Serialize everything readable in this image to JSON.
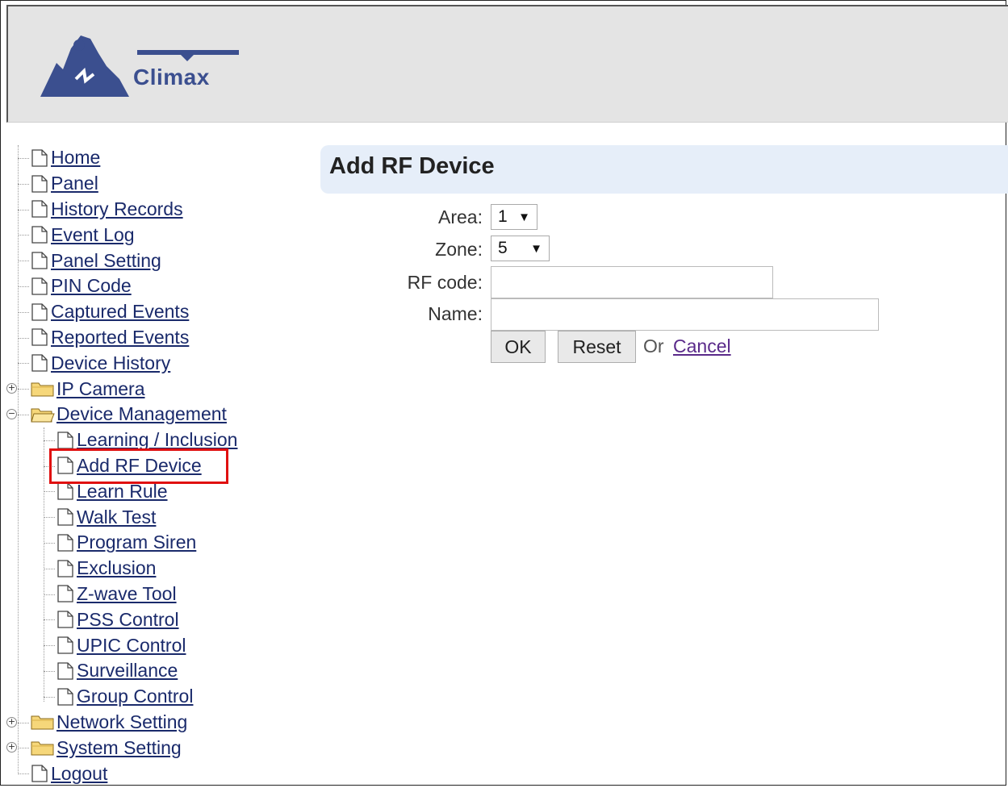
{
  "brand": {
    "name": "Climax"
  },
  "sidebar": {
    "items": [
      {
        "label": "Home",
        "type": "page",
        "level": 0
      },
      {
        "label": "Panel",
        "type": "page",
        "level": 0
      },
      {
        "label": "History Records",
        "type": "page",
        "level": 0
      },
      {
        "label": "Event Log",
        "type": "page",
        "level": 0
      },
      {
        "label": "Panel Setting",
        "type": "page",
        "level": 0
      },
      {
        "label": "PIN Code",
        "type": "page",
        "level": 0
      },
      {
        "label": "Captured Events",
        "type": "page",
        "level": 0
      },
      {
        "label": "Reported Events",
        "type": "page",
        "level": 0
      },
      {
        "label": "Device History",
        "type": "page",
        "level": 0
      },
      {
        "label": "IP Camera",
        "type": "folder",
        "level": 0,
        "expanded": false
      },
      {
        "label": "Device Management",
        "type": "folder",
        "level": 0,
        "expanded": true
      },
      {
        "label": "Learning / Inclusion",
        "type": "page",
        "level": 1
      },
      {
        "label": "Add RF Device",
        "type": "page",
        "level": 1,
        "selected": true
      },
      {
        "label": "Learn Rule",
        "type": "page",
        "level": 1
      },
      {
        "label": "Walk Test",
        "type": "page",
        "level": 1
      },
      {
        "label": "Program Siren",
        "type": "page",
        "level": 1
      },
      {
        "label": "Exclusion",
        "type": "page",
        "level": 1
      },
      {
        "label": "Z-wave Tool",
        "type": "page",
        "level": 1
      },
      {
        "label": "PSS Control",
        "type": "page",
        "level": 1
      },
      {
        "label": "UPIC Control",
        "type": "page",
        "level": 1
      },
      {
        "label": "Surveillance",
        "type": "page",
        "level": 1
      },
      {
        "label": "Group Control",
        "type": "page",
        "level": 1
      },
      {
        "label": "Network Setting",
        "type": "folder",
        "level": 0,
        "expanded": false
      },
      {
        "label": "System Setting",
        "type": "folder",
        "level": 0,
        "expanded": false
      },
      {
        "label": "Logout",
        "type": "page",
        "level": 0
      }
    ]
  },
  "main": {
    "title": "Add RF Device",
    "form": {
      "area_label": "Area:",
      "area_value": "1",
      "zone_label": "Zone:",
      "zone_value": "5",
      "rf_code_label": "RF code:",
      "rf_code_value": "",
      "name_label": "Name:",
      "name_value": "",
      "ok_label": "OK",
      "reset_label": "Reset",
      "or_text": "Or",
      "cancel_label": "Cancel"
    }
  },
  "colors": {
    "header_bg": "#e4e4e4",
    "title_bar_bg": "#e6eef9",
    "link": "#1a2a6b",
    "highlight_border": "#e01010",
    "brand": "#3b4f8f"
  }
}
